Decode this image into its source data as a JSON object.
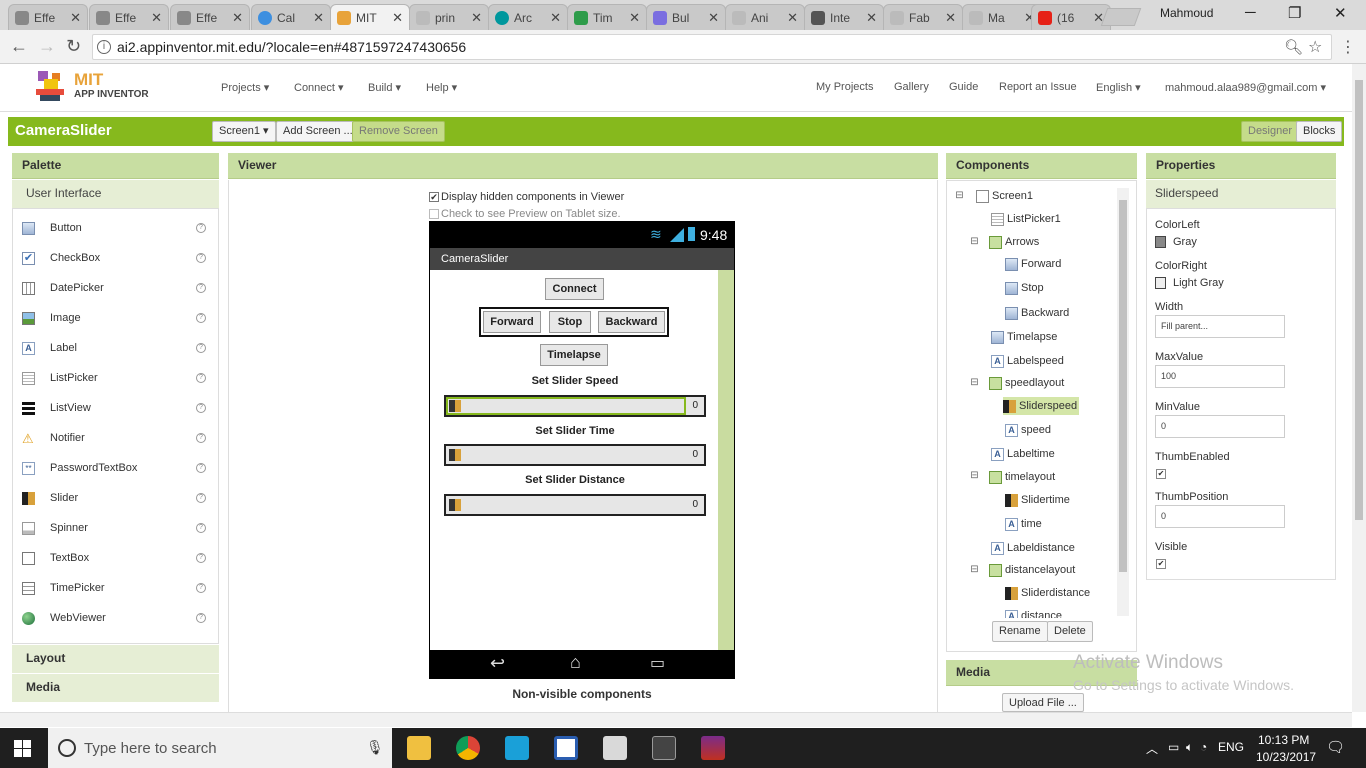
{
  "browser": {
    "tabs": [
      {
        "label": "Effe",
        "color": "#888888"
      },
      {
        "label": "Effe",
        "color": "#888888"
      },
      {
        "label": "Effe",
        "color": "#888888"
      },
      {
        "label": "Cal",
        "color": "#3d8fe0"
      },
      {
        "label": "MIT",
        "color": "#e8a33a"
      },
      {
        "label": "prin",
        "color": "#aaaaaa"
      },
      {
        "label": "Arc",
        "color": "#00979d"
      },
      {
        "label": "Tim",
        "color": "#2e9c4a"
      },
      {
        "label": "Bul",
        "color": "#7a6ee0"
      },
      {
        "label": "Ani",
        "color": "#aaaaaa"
      },
      {
        "label": "Inte",
        "color": "#555555"
      },
      {
        "label": "Fab",
        "color": "#aaaaaa"
      },
      {
        "label": "Ma",
        "color": "#aaaaaa"
      },
      {
        "label": "(16",
        "color": "#e62117"
      }
    ],
    "user": "Mahmoud",
    "url": "ai2.appinventor.mit.edu/?locale=en#4871597247430656"
  },
  "header": {
    "logo_top": "MIT",
    "logo_bottom": "APP INVENTOR",
    "menus": [
      "Projects ▾",
      "Connect ▾",
      "Build ▾",
      "Help ▾"
    ],
    "right_links": [
      "My Projects",
      "Gallery",
      "Guide",
      "Report an Issue",
      "English ▾",
      "mahmoud.alaa989@gmail.com ▾"
    ]
  },
  "projectbar": {
    "name": "CameraSlider",
    "screen_select": "Screen1 ▾",
    "add_screen": "Add Screen ...",
    "remove_screen": "Remove Screen",
    "designer": "Designer",
    "blocks": "Blocks"
  },
  "palette": {
    "title": "Palette",
    "category": "User Interface",
    "items": [
      "Button",
      "CheckBox",
      "DatePicker",
      "Image",
      "Label",
      "ListPicker",
      "ListView",
      "Notifier",
      "PasswordTextBox",
      "Slider",
      "Spinner",
      "TextBox",
      "TimePicker",
      "WebViewer"
    ],
    "help": "?",
    "layout": "Layout",
    "media": "Media"
  },
  "viewer": {
    "title": "Viewer",
    "show_hidden": "Display hidden components in Viewer",
    "tablet_preview": "Check to see Preview on Tablet size.",
    "time": "9:48",
    "app_title": "CameraSlider",
    "connect": "Connect",
    "forward": "Forward",
    "stop": "Stop",
    "backward": "Backward",
    "timelapse": "Timelapse",
    "label_speed": "Set Slider Speed",
    "label_time": "Set Slider Time",
    "label_distance": "Set Slider Distance",
    "slider_value": "0",
    "nonvisible": "Non-visible components"
  },
  "components": {
    "title": "Components",
    "tree": [
      "Screen1",
      "ListPicker1",
      "Arrows",
      "Forward",
      "Stop",
      "Backward",
      "Timelapse",
      "Labelspeed",
      "speedlayout",
      "Sliderspeed",
      "speed",
      "Labeltime",
      "timelayout",
      "Slidertime",
      "time",
      "Labeldistance",
      "distancelayout",
      "Sliderdistance",
      "distance"
    ],
    "rename": "Rename",
    "delete": "Delete"
  },
  "media": {
    "title": "Media",
    "upload": "Upload File ..."
  },
  "properties": {
    "title": "Properties",
    "component": "Sliderspeed",
    "colorleft_label": "ColorLeft",
    "colorleft_value": "Gray",
    "colorright_label": "ColorRight",
    "colorright_value": "Light Gray",
    "width_label": "Width",
    "width_value": "Fill parent...",
    "maxvalue_label": "MaxValue",
    "maxvalue_value": "100",
    "minvalue_label": "MinValue",
    "minvalue_value": "0",
    "thumbenabled_label": "ThumbEnabled",
    "thumbposition_label": "ThumbPosition",
    "thumbposition_value": "0",
    "visible_label": "Visible",
    "check": "✔"
  },
  "activation": {
    "line1": "Activate Windows",
    "line2": "Go to Settings to activate Windows."
  },
  "taskbar": {
    "search_placeholder": "Type here to search",
    "lang": "ENG",
    "time": "10:13 PM",
    "date": "10/23/2017"
  },
  "colors": {
    "green": "#86b91d",
    "panel_header": "#c8dea2",
    "accent_orange": "#e8a33a"
  }
}
